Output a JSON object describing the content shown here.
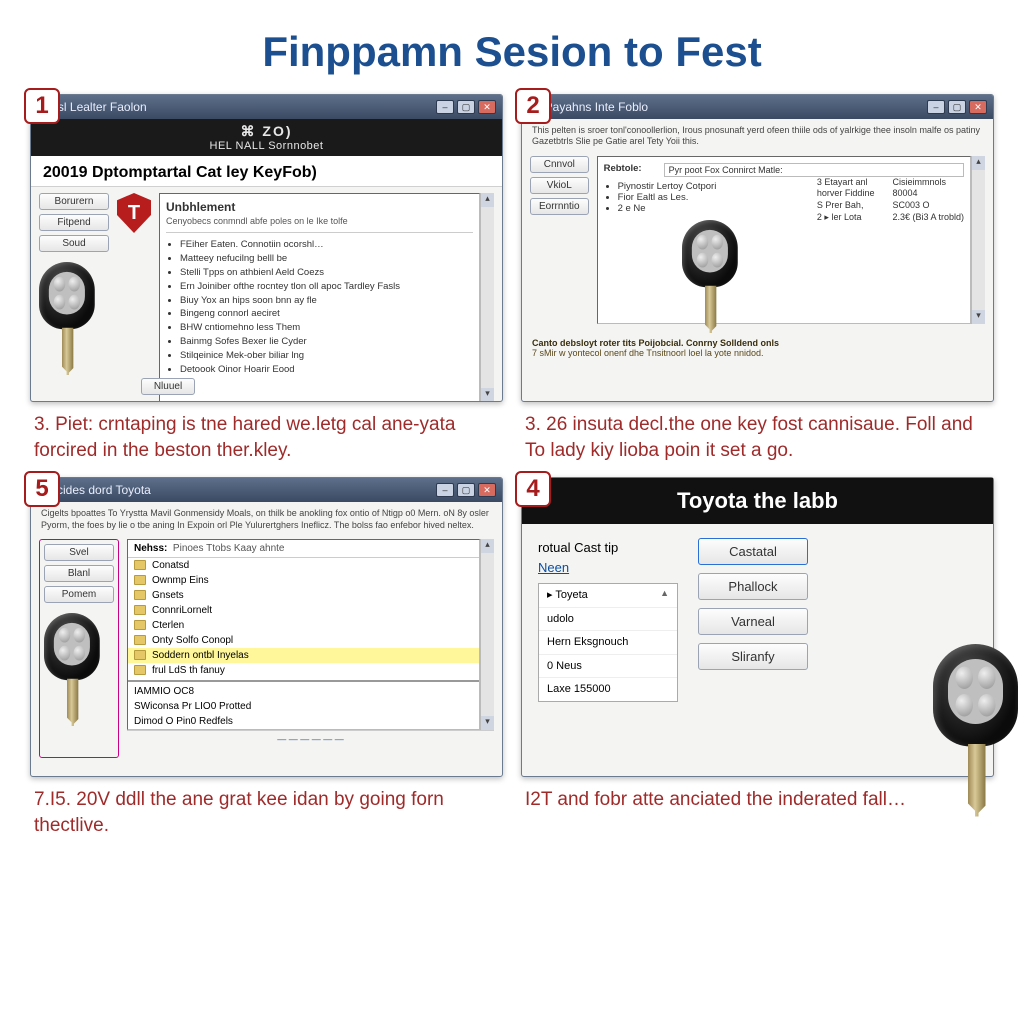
{
  "title": "Finppamn Sesion to Fest",
  "panels": {
    "p1": {
      "step": "1",
      "win_title": "Yirgsl Lealter Faolon",
      "banner_top": "⌘ ZO)",
      "banner_sub": "HEL NALL Sornnobet",
      "heading": "20019 Dptomptartal Cat ley KeyFob)",
      "side_buttons": [
        "Borurern",
        "Fitpend",
        "Soud"
      ],
      "panel_title": "Unbhlement",
      "panel_sub": "Cenyobecs conmndl abfe poles on le Ike tolfe",
      "bullets": [
        "FEiher Eaten. Connotiin ocorshl…",
        "Matteey nefucilng belll be",
        "Stelli Tpps on athbienl Aeld Coezs",
        "Ern Joiniber ofthe rocntey tlon oll apoc Tardley Fasls",
        "Biuy Yox an hips soon bnn ay fle",
        "Bingeng connorl aeciret",
        "BHW cntiomehno less Them",
        "Bainmg Sofes Bexer lie Cyder",
        "Stilqeinice Mek-ober biliar lng",
        "Detoook Oinor Hoarir Eood"
      ],
      "footer_btn": "Nluuel",
      "caption": "3. Piet: crntaping is tne hared we.letg cal ane-yata forcired in the beston ther.kley."
    },
    "p2": {
      "step": "2",
      "win_title": "02 Payahns Inte Foblo",
      "intro": "This pelten is sroer tonl'conoollerlion, Irous pnosunaft yerd ofeen thiile ods of yalrkige thee insoln malfe os patiny Gazetbtrls Slie pe Gatie arel Tety Yoii this.",
      "side_buttons": [
        "Cnnvol",
        "VkioL",
        "Eorrnntio"
      ],
      "label": "Rebtole:",
      "combo_value": "Pyr poot Fox Connirct Matle:",
      "list_items": [
        "Piynostir Lertoy Cotpori",
        "Fior Ealtl as Les.",
        "2 e Ne"
      ],
      "right_col": [
        "Cisieimmnols",
        "80004",
        "SC003 O",
        "2.3€ (Bi3 A trobld)"
      ],
      "mid_lines": [
        "3 Etayart anl",
        "horver Fiddine",
        "S Prer Bah,",
        "2 ▸ ler Lota"
      ],
      "foot_bold": "Canto debsloyt roter tits Poijobcial. Conrny Solldend onls",
      "foot_small": "7 sMir w yontecol onenf dhe Tnsitnoorl loel la yote nnidod.",
      "caption": "3. 26 insuta decl.the one key fost cannisaue. Foll and To lady kiy lioba poin it set a go."
    },
    "p5": {
      "step": "5",
      "win_title": "7 Incides dord Toyota",
      "intro": "Cigelts bpoattes To Yrystta Mavil Gonmensidy Moals, on thilk be anokling fox ontio of Ntigp o0 Mern. oN 8y osler Pyorm, the foes by lie o tbe aning In Expoin orl Ple Yulurertghers Ineflicz. The bolss fao enfebor hived neltex.",
      "side_buttons": [
        "Svel",
        "Blanl",
        "Pomem"
      ],
      "list_header": "Nehss:",
      "list_subtitle": "Pinoes Ttobs Kaay ahnte",
      "items": [
        "Conatsd",
        "Ownmp Eins",
        "Gnsets",
        "ConnriLornelt",
        "Cterlen",
        "Onty Solfo Conopl",
        "Soddern ontbl  Inyelas",
        "frul       LdS th fanuy"
      ],
      "bottom_lines": [
        "IAMMIO OC8",
        "SWiconsa Pr LIO0 Protted",
        "Dimod O Pin0 Redfels"
      ],
      "footer": "—  —  —  —  —  —",
      "caption": "7.I5. 20V ddll the ane grat kee idan by going forn thectlive."
    },
    "p4": {
      "step": "4",
      "header": "Toyota the labb",
      "left_label1": "rotual Cast tip",
      "left_link": "Neen",
      "options": [
        "▸ Toyeta",
        "udolo",
        "Hern Eksgnouch",
        "0 Neus",
        "Laxe 155000"
      ],
      "buttons": [
        "Castatal",
        "Phallock",
        "Varneal",
        "Sliranfy"
      ],
      "caption": "I2T and fobr atte anciated the inderated fall…"
    }
  }
}
